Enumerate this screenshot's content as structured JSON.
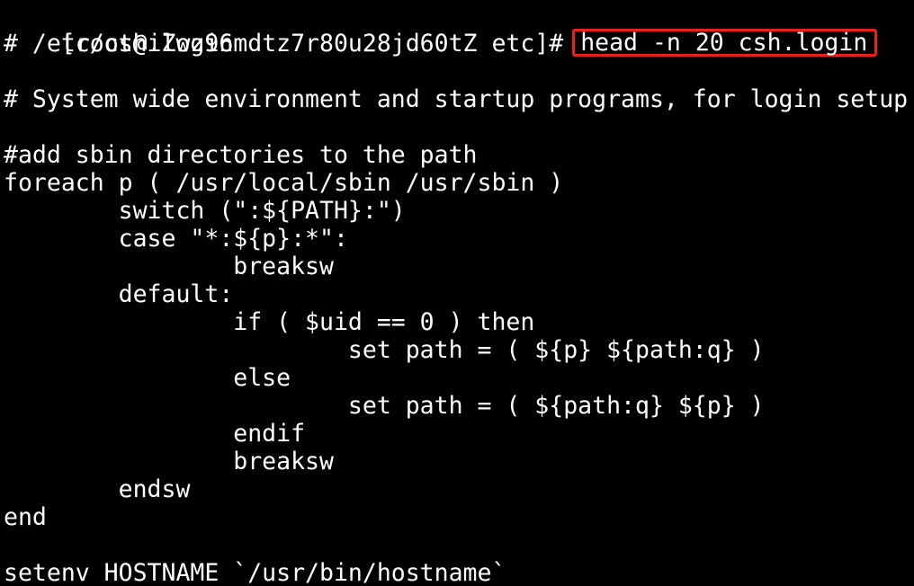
{
  "terminal": {
    "prompt": "[root@iZwz96mdtz7r80u28jd60tZ etc]# ",
    "command": "head -n 20 csh.login",
    "highlight_color": "#e8201f",
    "text_color": "#ffffff",
    "background_color": "#000000",
    "output": [
      "# /etc/csh.login",
      "",
      "# System wide environment and startup programs, for login setup",
      "",
      "#add sbin directories to the path",
      "foreach p ( /usr/local/sbin /usr/sbin )",
      "        switch (\":${PATH}:\")",
      "        case \"*:${p}:*\":",
      "                breaksw",
      "        default:",
      "                if ( $uid == 0 ) then",
      "                        set path = ( ${p} ${path:q} )",
      "                else",
      "                        set path = ( ${path:q} ${p} )",
      "                endif",
      "                breaksw",
      "        endsw",
      "end",
      "",
      "setenv HOSTNAME `/usr/bin/hostname`"
    ]
  }
}
